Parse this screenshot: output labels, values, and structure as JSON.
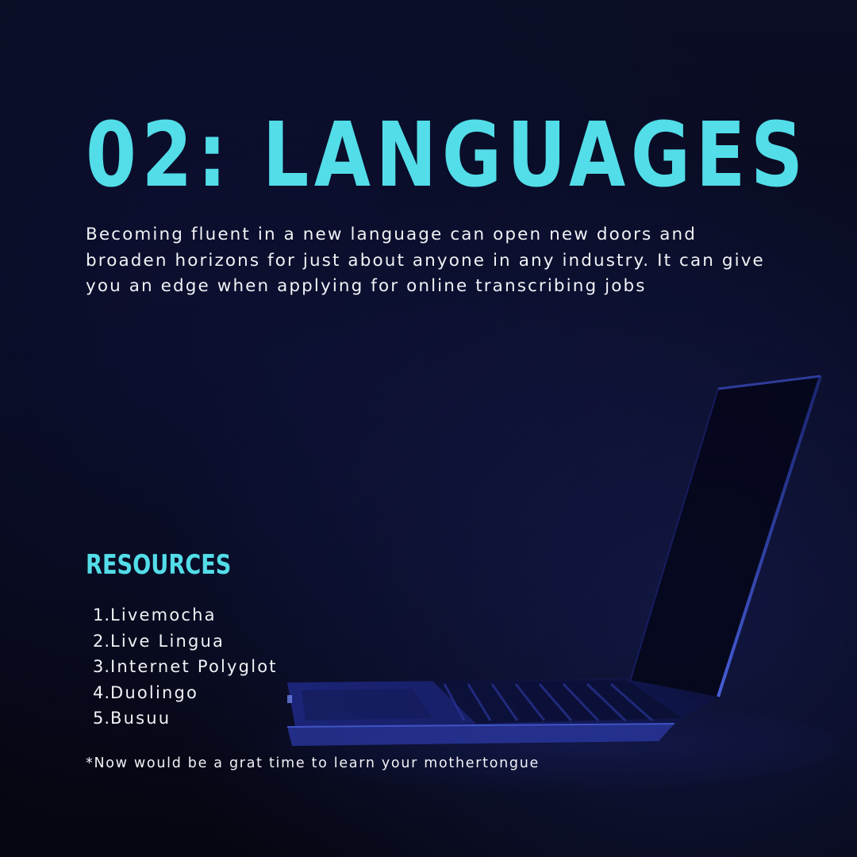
{
  "title": "02: LANGUAGES",
  "intro": "Becoming fluent in a new language can open new doors and broaden horizons for just about anyone in any industry. It can give you an edge when applying for online transcribing jobs",
  "resources": {
    "heading": "RESOURCES",
    "items": [
      {
        "number": "1.",
        "label": "Livemocha"
      },
      {
        "number": "2.",
        "label": "Live Lingua"
      },
      {
        "number": "3.",
        "label": "Internet Polyglot"
      },
      {
        "number": "4.",
        "label": "Duolingo"
      },
      {
        "number": "5.",
        "label": "Busuu"
      }
    ]
  },
  "footnote": "*Now would be a grat time to learn your mothertongue",
  "colors": {
    "accent": "#52dde8",
    "text": "#f1f2f6",
    "background": "#080a1d",
    "laptop_glow": "#3a4fd0"
  },
  "background_image": "dark-laptop-silhouette"
}
